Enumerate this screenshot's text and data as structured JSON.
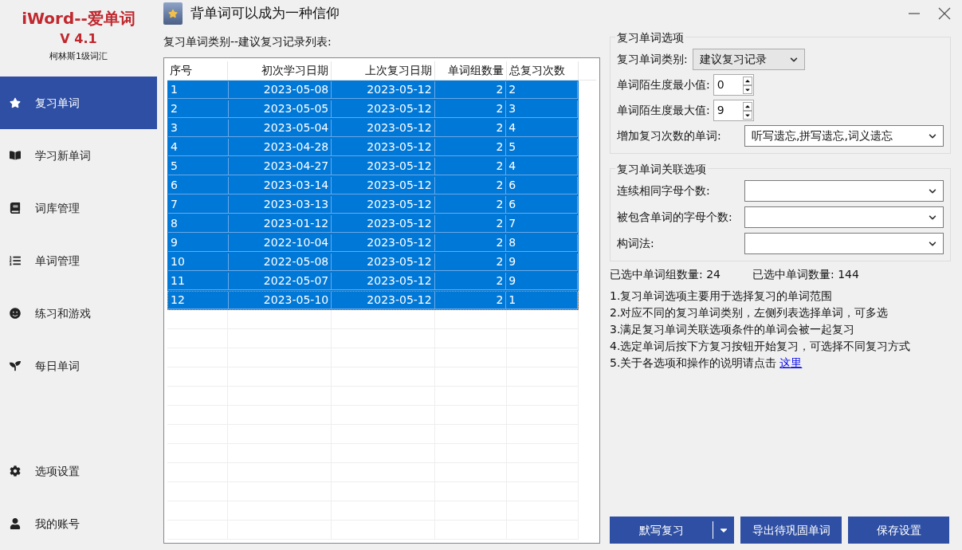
{
  "app": {
    "name": "iWord--爱单词",
    "version": "V 4.1",
    "vocabulary": "柯林斯1级词汇"
  },
  "sidebar": {
    "items": [
      {
        "label": "复习单词",
        "selected": true
      },
      {
        "label": "学习新单词",
        "selected": false
      },
      {
        "label": "词库管理",
        "selected": false
      },
      {
        "label": "单词管理",
        "selected": false
      },
      {
        "label": "练习和游戏",
        "selected": false
      },
      {
        "label": "每日单词",
        "selected": false
      }
    ],
    "bottom_items": [
      {
        "label": "选项设置",
        "selected": false
      },
      {
        "label": "我的账号",
        "selected": false
      }
    ]
  },
  "window": {
    "title": "背单词可以成为一种信仰"
  },
  "list": {
    "caption": "复习单词类别--建议复习记录列表:",
    "columns": [
      "序号",
      "初次学习日期",
      "上次复习日期",
      "单词组数量",
      "总复习次数"
    ],
    "rows": [
      {
        "cells": [
          "1",
          "2023-05-08",
          "2023-05-12",
          "2",
          "2"
        ],
        "selected": true,
        "focused": false
      },
      {
        "cells": [
          "2",
          "2023-05-05",
          "2023-05-12",
          "2",
          "3"
        ],
        "selected": true,
        "focused": false
      },
      {
        "cells": [
          "3",
          "2023-05-04",
          "2023-05-12",
          "2",
          "4"
        ],
        "selected": true,
        "focused": false
      },
      {
        "cells": [
          "4",
          "2023-04-28",
          "2023-05-12",
          "2",
          "5"
        ],
        "selected": true,
        "focused": false
      },
      {
        "cells": [
          "5",
          "2023-04-27",
          "2023-05-12",
          "2",
          "4"
        ],
        "selected": true,
        "focused": false
      },
      {
        "cells": [
          "6",
          "2023-03-14",
          "2023-05-12",
          "2",
          "6"
        ],
        "selected": true,
        "focused": false
      },
      {
        "cells": [
          "7",
          "2023-03-13",
          "2023-05-12",
          "2",
          "6"
        ],
        "selected": true,
        "focused": false
      },
      {
        "cells": [
          "8",
          "2023-01-12",
          "2023-05-12",
          "2",
          "7"
        ],
        "selected": true,
        "focused": false
      },
      {
        "cells": [
          "9",
          "2022-10-04",
          "2023-05-12",
          "2",
          "8"
        ],
        "selected": true,
        "focused": false
      },
      {
        "cells": [
          "10",
          "2022-05-08",
          "2023-05-12",
          "2",
          "9"
        ],
        "selected": true,
        "focused": false
      },
      {
        "cells": [
          "11",
          "2022-05-07",
          "2023-05-12",
          "2",
          "9"
        ],
        "selected": true,
        "focused": false
      },
      {
        "cells": [
          "12",
          "2023-05-10",
          "2023-05-12",
          "2",
          "1"
        ],
        "selected": true,
        "focused": true
      }
    ]
  },
  "review_options": {
    "title": "复习单词选项",
    "category": {
      "label": "复习单词类别:",
      "value": "建议复习记录"
    },
    "min": {
      "label": "单词陌生度最小值:",
      "value": "0"
    },
    "max": {
      "label": "单词陌生度最大值:",
      "value": "9"
    },
    "increase": {
      "label": "增加复习次数的单词:",
      "value": "听写遗忘,拼写遗忘,词义遗忘"
    }
  },
  "related_options": {
    "title": "复习单词关联选项",
    "fields": [
      {
        "label": "连续相同字母个数:"
      },
      {
        "label": "被包含单词的字母个数:"
      },
      {
        "label": "构词法:"
      }
    ]
  },
  "counts": [
    {
      "label": "已选中单词组数量:",
      "value": "24"
    },
    {
      "label": "已选中单词数量:",
      "value": "144"
    }
  ],
  "notes": [
    "1.复习单词选项主要用于选择复习的单词范围",
    "2.对应不同的复习单词类别，左侧列表选择单词，可多选",
    "3.满足复习单词关联选项条件的单词会被一起复习",
    "4.选定单词后按下方复习按钮开始复习，可选择不同复习方式"
  ],
  "help_note": {
    "text": "5.关于各选项和操作的说明请点击",
    "link": "这里"
  },
  "buttons": {
    "review": "默写复习",
    "export": "导出待巩固单词",
    "save": "保存设置"
  }
}
